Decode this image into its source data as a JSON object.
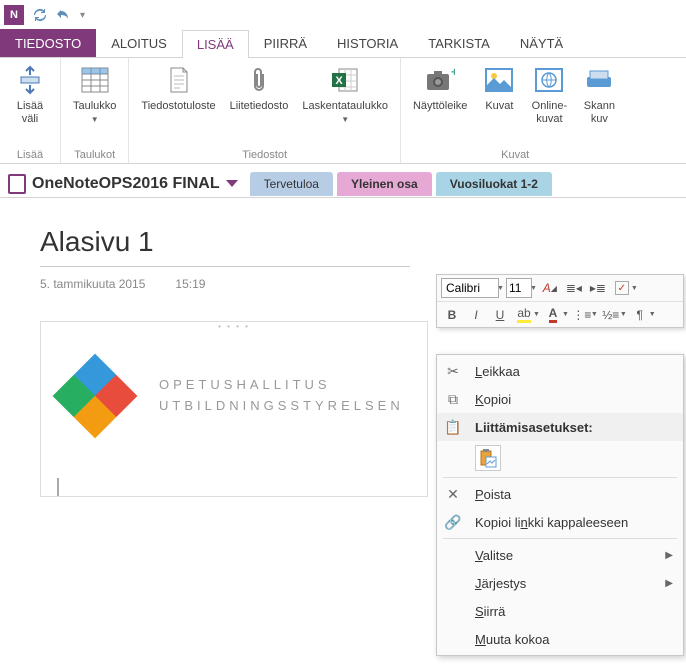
{
  "app": {
    "name": "OneNote"
  },
  "tabs": {
    "file": "TIEDOSTO",
    "items": [
      "ALOITUS",
      "LISÄÄ",
      "PIIRRÄ",
      "HISTORIA",
      "TARKISTA",
      "NÄYTÄ"
    ],
    "active_index": 1
  },
  "ribbon": {
    "groups": [
      {
        "title": "Lisää",
        "buttons": [
          {
            "label": "Lisää\nväli",
            "icon": "insert-space"
          }
        ]
      },
      {
        "title": "Taulukot",
        "buttons": [
          {
            "label": "Taulukko",
            "icon": "table",
            "dropdown": true
          }
        ]
      },
      {
        "title": "Tiedostot",
        "buttons": [
          {
            "label": "Tiedostotuloste",
            "icon": "file-printout"
          },
          {
            "label": "Liitetiedosto",
            "icon": "attachment"
          },
          {
            "label": "Laskentataulukko",
            "icon": "spreadsheet",
            "dropdown": true
          }
        ]
      },
      {
        "title": "Kuvat",
        "buttons": [
          {
            "label": "Näyttöleike",
            "icon": "screen-clip"
          },
          {
            "label": "Kuvat",
            "icon": "pictures"
          },
          {
            "label": "Online-\nkuvat",
            "icon": "online-pictures"
          },
          {
            "label": "Skann\nkuv",
            "icon": "scanner"
          }
        ]
      }
    ]
  },
  "notebook": {
    "name": "OneNoteOPS2016 FINAL"
  },
  "sections": [
    "Tervetuloa",
    "Yleinen osa",
    "Vuosiluokat 1-2"
  ],
  "page": {
    "title": "Alasivu 1",
    "date": "5. tammikuuta 2015",
    "time": "15:19"
  },
  "content_logo": {
    "line1": "OPETUSHALLITUS",
    "line2": "UTBILDNINGSSTYRELSEN"
  },
  "float_toolbar": {
    "font_name": "Calibri",
    "font_size": "11"
  },
  "context_menu": {
    "cut": "Leikkaa",
    "copy": "Kopioi",
    "paste_header": "Liittämisasetukset:",
    "delete": "Poista",
    "copy_link": "Kopioi linkki kappaleeseen",
    "select": "Valitse",
    "order": "Järjestys",
    "move": "Siirrä",
    "resize": "Muuta kokoa"
  }
}
